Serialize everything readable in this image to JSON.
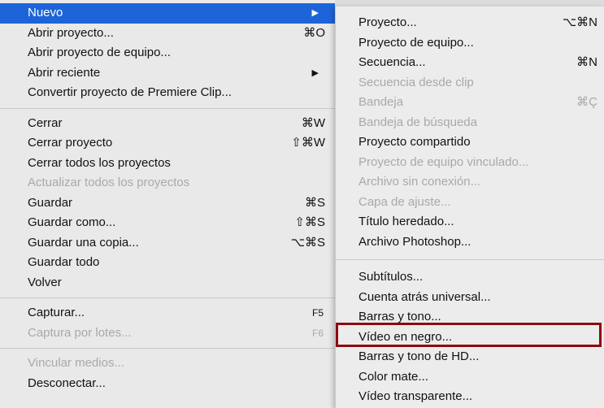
{
  "menu": {
    "nuevo": {
      "label": "Nuevo",
      "arrow": "▶"
    },
    "abrir_proyecto": {
      "label": "Abrir proyecto...",
      "shortcut": "⌘O"
    },
    "abrir_proyecto_equipo": {
      "label": "Abrir proyecto de equipo..."
    },
    "abrir_reciente": {
      "label": "Abrir reciente",
      "arrow": "▶"
    },
    "convertir": {
      "label": "Convertir proyecto de Premiere Clip..."
    },
    "cerrar": {
      "label": "Cerrar",
      "shortcut": "⌘W"
    },
    "cerrar_proyecto": {
      "label": "Cerrar proyecto",
      "shortcut": "⇧⌘W"
    },
    "cerrar_todos": {
      "label": "Cerrar todos los proyectos"
    },
    "actualizar_todos": {
      "label": "Actualizar todos los proyectos"
    },
    "guardar": {
      "label": "Guardar",
      "shortcut": "⌘S"
    },
    "guardar_como": {
      "label": "Guardar como...",
      "shortcut": "⇧⌘S"
    },
    "guardar_copia": {
      "label": "Guardar una copia...",
      "shortcut": "⌥⌘S"
    },
    "guardar_todo": {
      "label": "Guardar todo"
    },
    "volver": {
      "label": "Volver"
    },
    "capturar": {
      "label": "Capturar...",
      "shortcut": "F5"
    },
    "captura_lotes": {
      "label": "Captura por lotes...",
      "shortcut": "F6"
    },
    "vincular_medios": {
      "label": "Vincular medios..."
    },
    "desconectar": {
      "label": "Desconectar..."
    }
  },
  "submenu": {
    "proyecto": {
      "label": "Proyecto...",
      "shortcut": "⌥⌘N"
    },
    "proyecto_equipo": {
      "label": "Proyecto de equipo..."
    },
    "secuencia": {
      "label": "Secuencia...",
      "shortcut": "⌘N"
    },
    "secuencia_desde_clip": {
      "label": "Secuencia desde clip"
    },
    "bandeja": {
      "label": "Bandeja",
      "shortcut": "⌘Ç"
    },
    "bandeja_busqueda": {
      "label": "Bandeja de búsqueda"
    },
    "proyecto_compartido": {
      "label": "Proyecto compartido"
    },
    "proyecto_equipo_vinculado": {
      "label": "Proyecto de equipo vinculado..."
    },
    "archivo_sin_conexion": {
      "label": "Archivo sin conexión..."
    },
    "capa_ajuste": {
      "label": "Capa de ajuste..."
    },
    "titulo_heredado": {
      "label": "Título heredado..."
    },
    "archivo_photoshop": {
      "label": "Archivo Photoshop..."
    },
    "subtitulos": {
      "label": "Subtítulos..."
    },
    "cuenta_atras": {
      "label": "Cuenta atrás universal..."
    },
    "barras_tono": {
      "label": "Barras y tono..."
    },
    "video_negro": {
      "label": "Vídeo en negro..."
    },
    "barras_tono_hd": {
      "label": "Barras y tono de HD..."
    },
    "color_mate": {
      "label": "Color mate..."
    },
    "video_transparente": {
      "label": "Vídeo transparente..."
    }
  },
  "colors": {
    "selection": "#1d64d9",
    "highlight_box": "#8b0c10",
    "disabled_text": "#a9a9a9"
  }
}
